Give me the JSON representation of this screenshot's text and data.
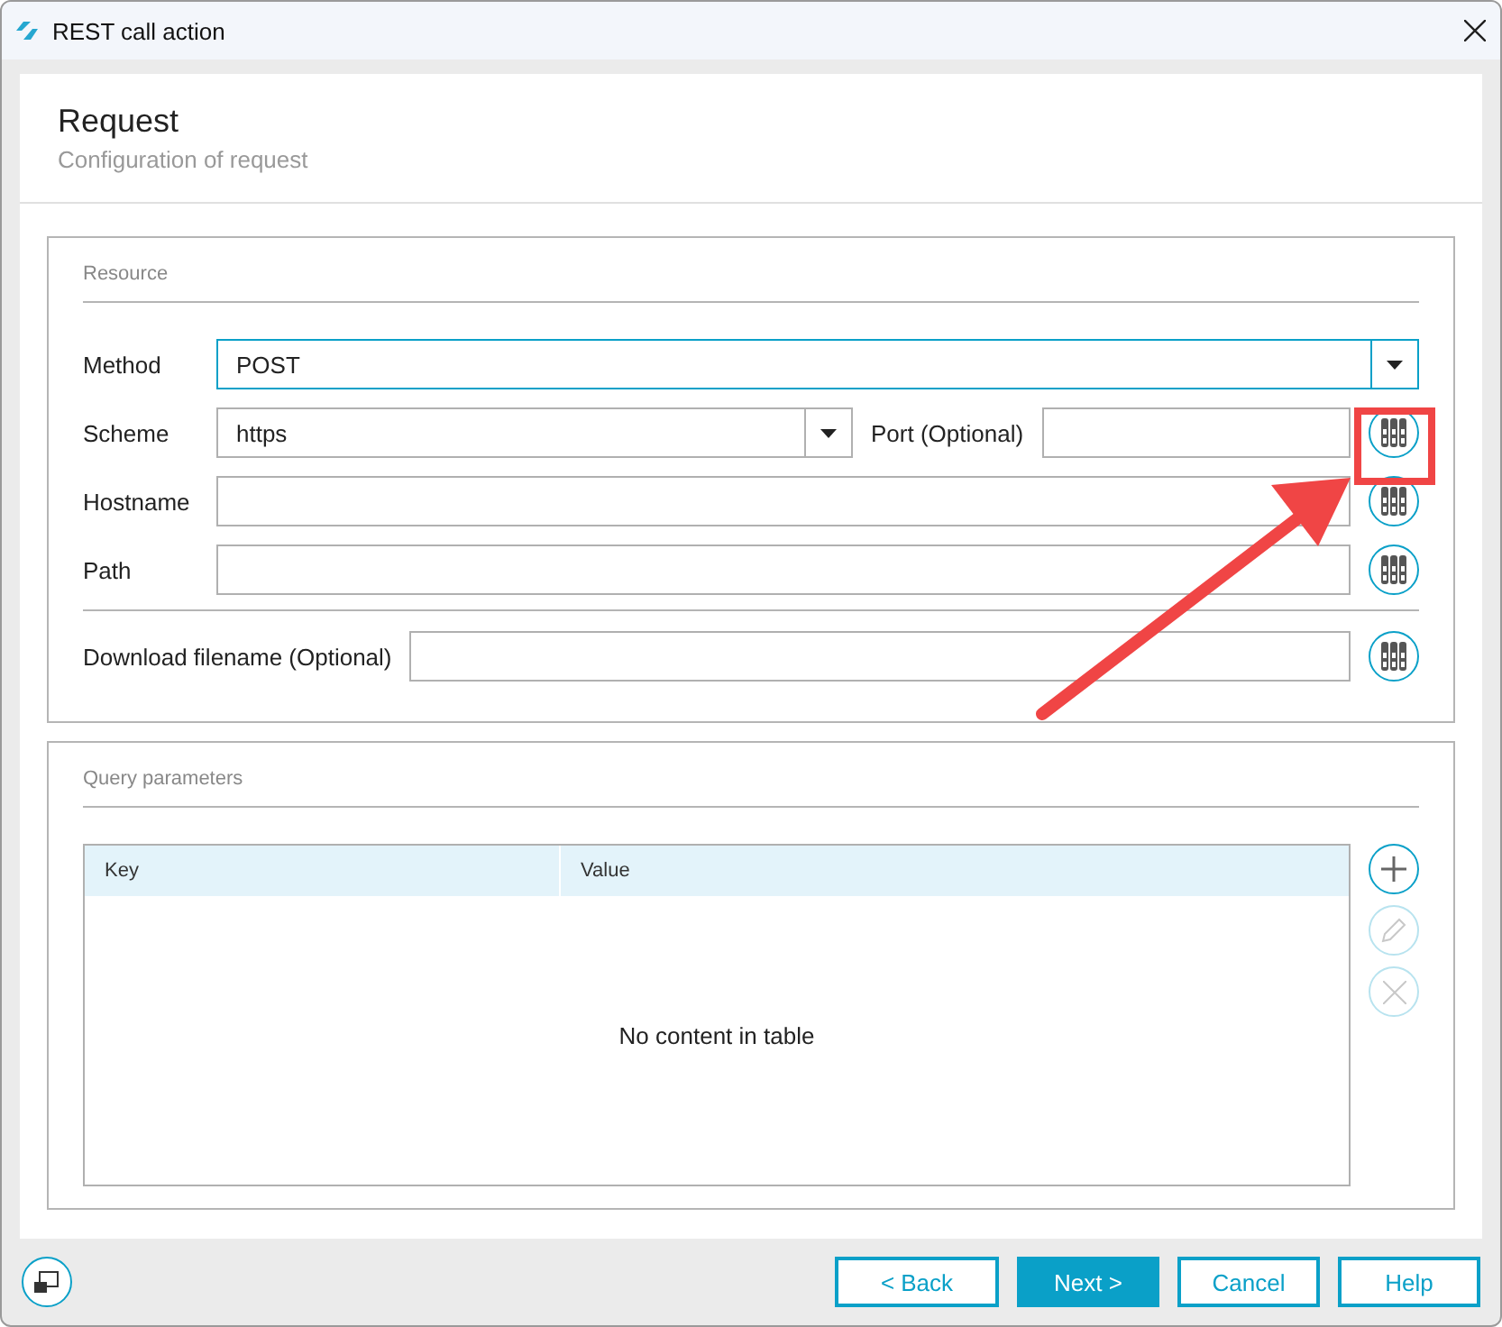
{
  "window": {
    "title": "REST call action"
  },
  "header": {
    "title": "Request",
    "subtitle": "Configuration of request"
  },
  "resource": {
    "title": "Resource",
    "fields": [
      {
        "kind": "dropdown",
        "label": "Method",
        "value": "POST"
      },
      {
        "kind": "dropdown-port",
        "label": "Scheme",
        "value": "https",
        "port_label": "Port (Optional)"
      },
      {
        "kind": "text",
        "label": "Hostname"
      },
      {
        "kind": "text",
        "label": "Path"
      },
      {
        "kind": "text",
        "label": "Download filename (Optional)",
        "separated": true
      }
    ]
  },
  "query": {
    "title": "Query parameters",
    "columns": [
      "Key",
      "Value"
    ],
    "empty_text": "No content in table",
    "actions": [
      {
        "kind": "add",
        "disabled": false
      },
      {
        "kind": "edit",
        "disabled": true
      },
      {
        "kind": "delete",
        "disabled": true
      }
    ]
  },
  "footer": {
    "buttons": [
      {
        "label": "< Back",
        "primary": false
      },
      {
        "label": "Next >",
        "primary": true
      },
      {
        "label": "Cancel",
        "primary": false
      },
      {
        "label": "Help",
        "primary": false
      }
    ]
  }
}
